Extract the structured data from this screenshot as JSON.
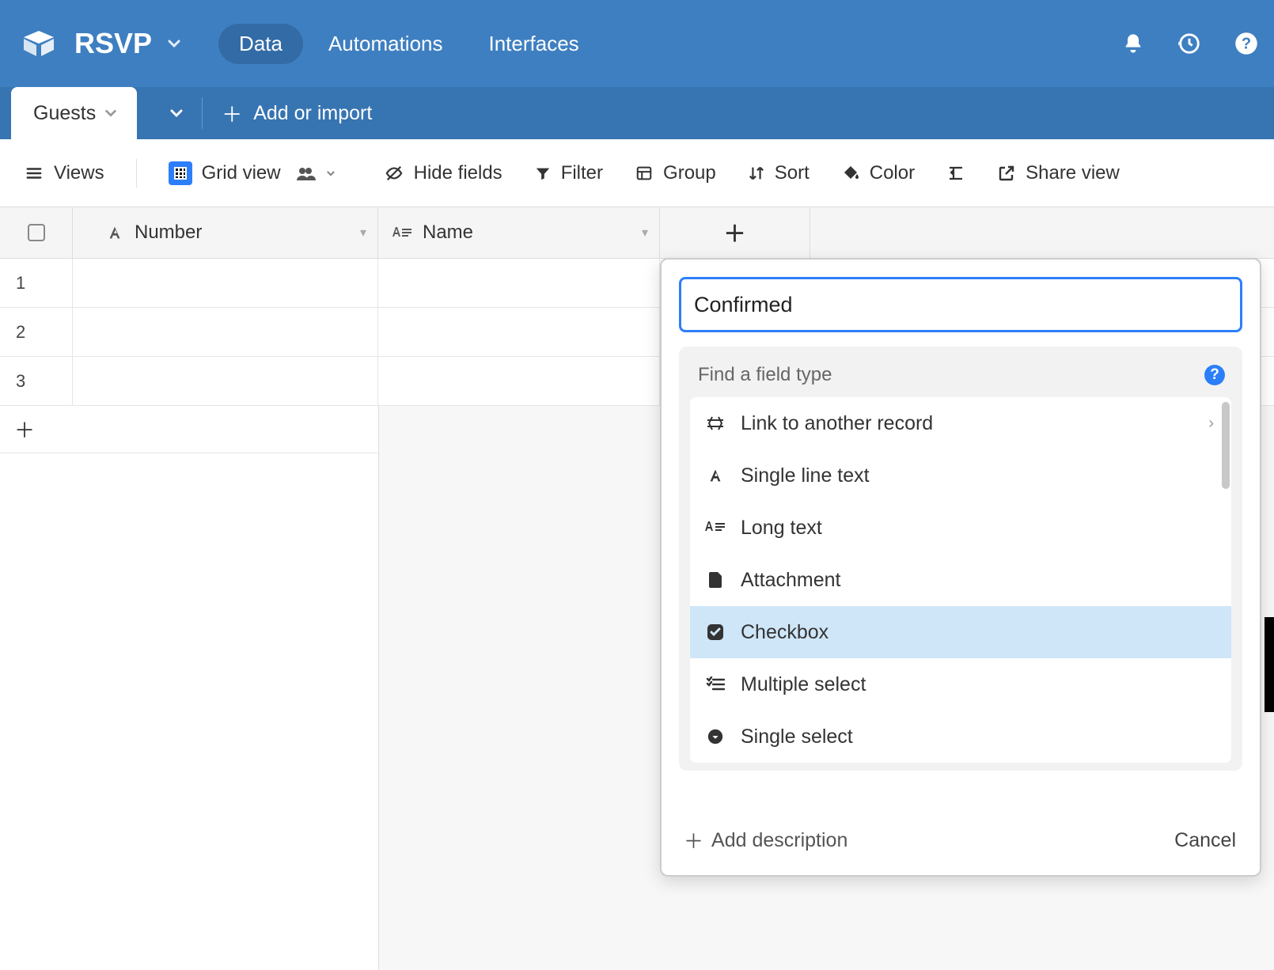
{
  "base": {
    "name": "RSVP"
  },
  "topbar": {
    "tabs": {
      "data": "Data",
      "automations": "Automations",
      "interfaces": "Interfaces"
    }
  },
  "tabletabs": {
    "active": "Guests",
    "add_or_import": "Add or import"
  },
  "toolbar": {
    "views": "Views",
    "grid_view": "Grid view",
    "hide_fields": "Hide fields",
    "filter": "Filter",
    "group": "Group",
    "sort": "Sort",
    "color": "Color",
    "share_view": "Share view"
  },
  "columns": {
    "number": "Number",
    "name": "Name"
  },
  "rows": [
    "1",
    "2",
    "3"
  ],
  "flyout": {
    "name_value": "Confirmed",
    "find_placeholder": "Find a field type",
    "types": {
      "link": "Link to another record",
      "single_line": "Single line text",
      "long_text": "Long text",
      "attachment": "Attachment",
      "checkbox": "Checkbox",
      "multiple_select": "Multiple select",
      "single_select": "Single select"
    },
    "add_description": "Add description",
    "cancel": "Cancel"
  }
}
